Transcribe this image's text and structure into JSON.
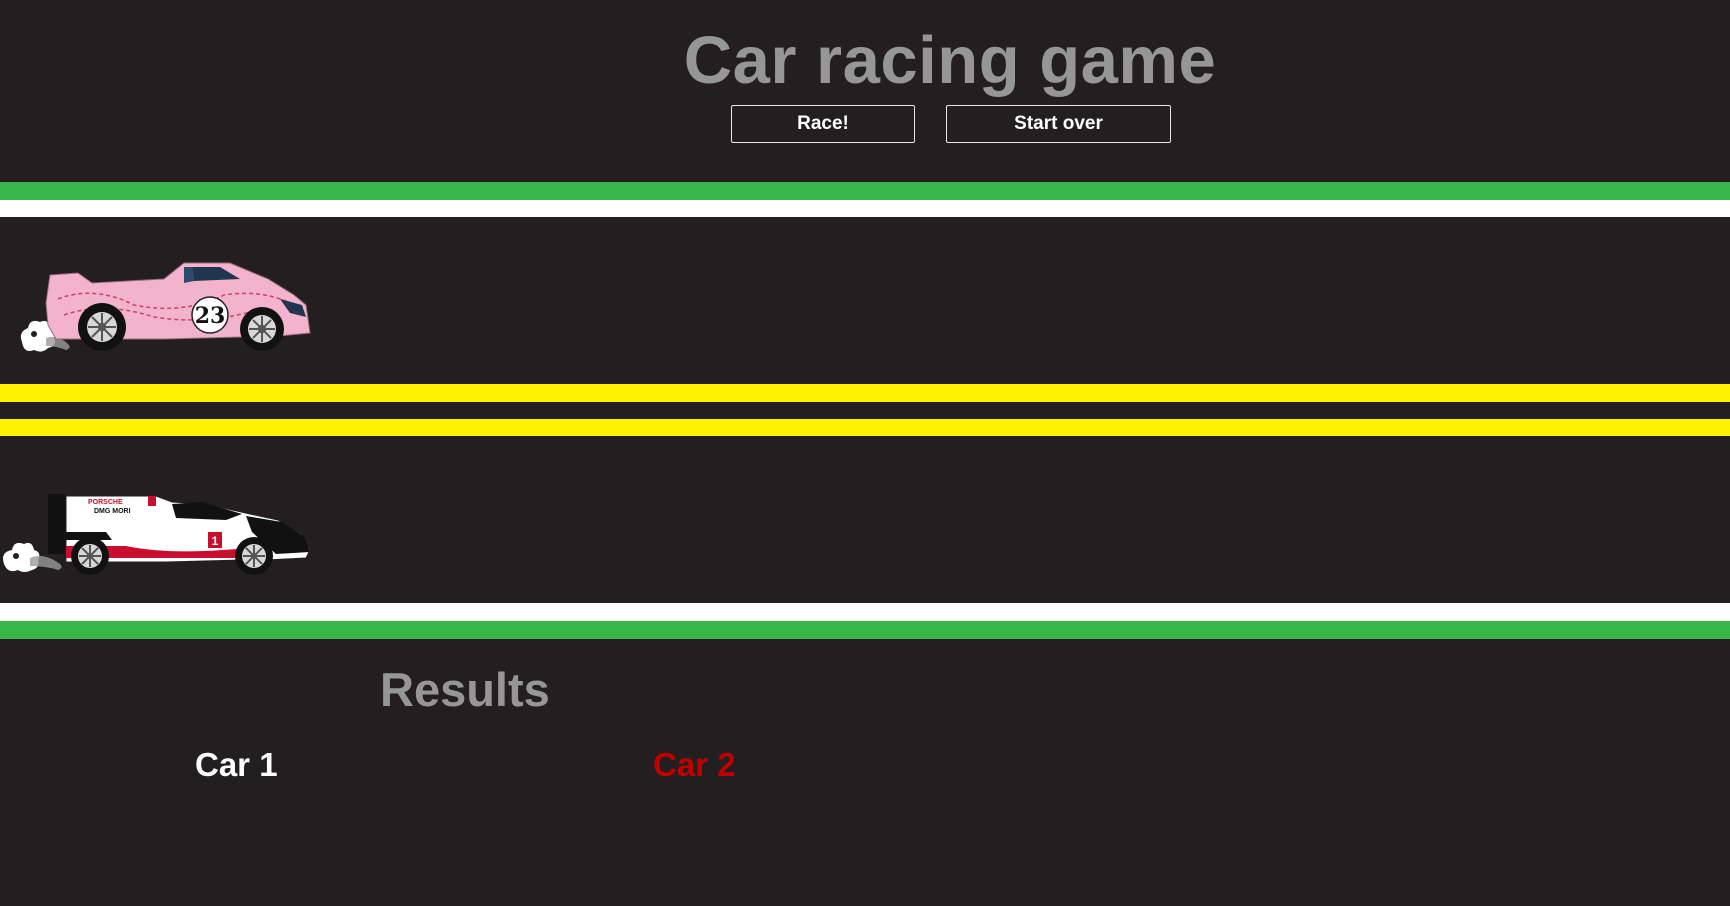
{
  "header": {
    "title": "Car racing game",
    "race_button": "Race!",
    "start_over_button": "Start over"
  },
  "track": {
    "colors": {
      "grass": "#3ab54a",
      "edge_line": "#ffffff",
      "center_line": "#fff200",
      "asphalt": "#231f20"
    },
    "lanes": [
      {
        "car": "Car 1",
        "livery": "pink",
        "car_number": "23"
      },
      {
        "car": "Car 2",
        "livery": "white-red-black",
        "car_number": "1",
        "sponsor_lines": [
          "PORSCHE",
          "DMG MORI"
        ]
      }
    ]
  },
  "results": {
    "title": "Results",
    "entries": [
      {
        "label": "Car 1",
        "color": "#ffffff"
      },
      {
        "label": "Car 2",
        "color": "#c00000"
      }
    ]
  }
}
